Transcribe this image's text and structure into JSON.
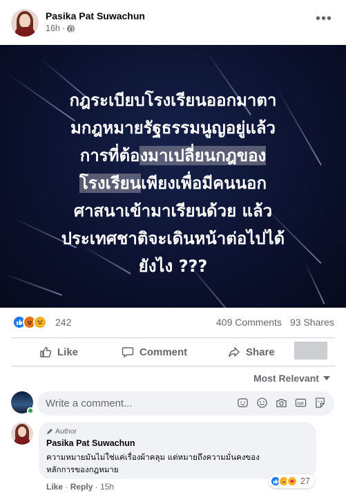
{
  "post": {
    "author": "Pasika Pat Suwachun",
    "time": "16h",
    "time_separator": "·",
    "more_label": "•••",
    "image_text_lines": [
      "กฎระเบียบโรงเรียนออกมาตา",
      "มกฎหมายรัฐธรรมนูญอยู่แล้ว",
      "การที่ต้อ",
      "งมาเปลี่ยนกฎของ",
      "โรงเรียน",
      "เพียงเพื่อมีคนนอก",
      "ศาสนาเข้ามาเรียนด้วย แล้ว",
      "ประเทศชาติจะเดินหน้าต่อไปได้",
      "ยังไง ???"
    ]
  },
  "stats": {
    "reaction_count": "242",
    "comments": "409 Comments",
    "shares": "93 Shares"
  },
  "actions": {
    "like": "Like",
    "comment": "Comment",
    "share": "Share"
  },
  "sort_label": "Most Relevant",
  "composer": {
    "placeholder": "Write a comment..."
  },
  "comment": {
    "badge": "Author",
    "author": "Pasika Pat Suwachun",
    "text_line1": "ความหมายมันไม่ใช่แค่เรื่องผ้าคลุม แต่หมายถึงความมั่นคงของ",
    "text_line2": "หลักการของกฎหมาย",
    "reaction_count": "27",
    "like": "Like",
    "reply": "Reply",
    "separator": "·",
    "time": "15h"
  },
  "colors": {
    "accent": "#1877f2",
    "secondary_text": "#65676b",
    "image_bg": "#0c1230"
  }
}
